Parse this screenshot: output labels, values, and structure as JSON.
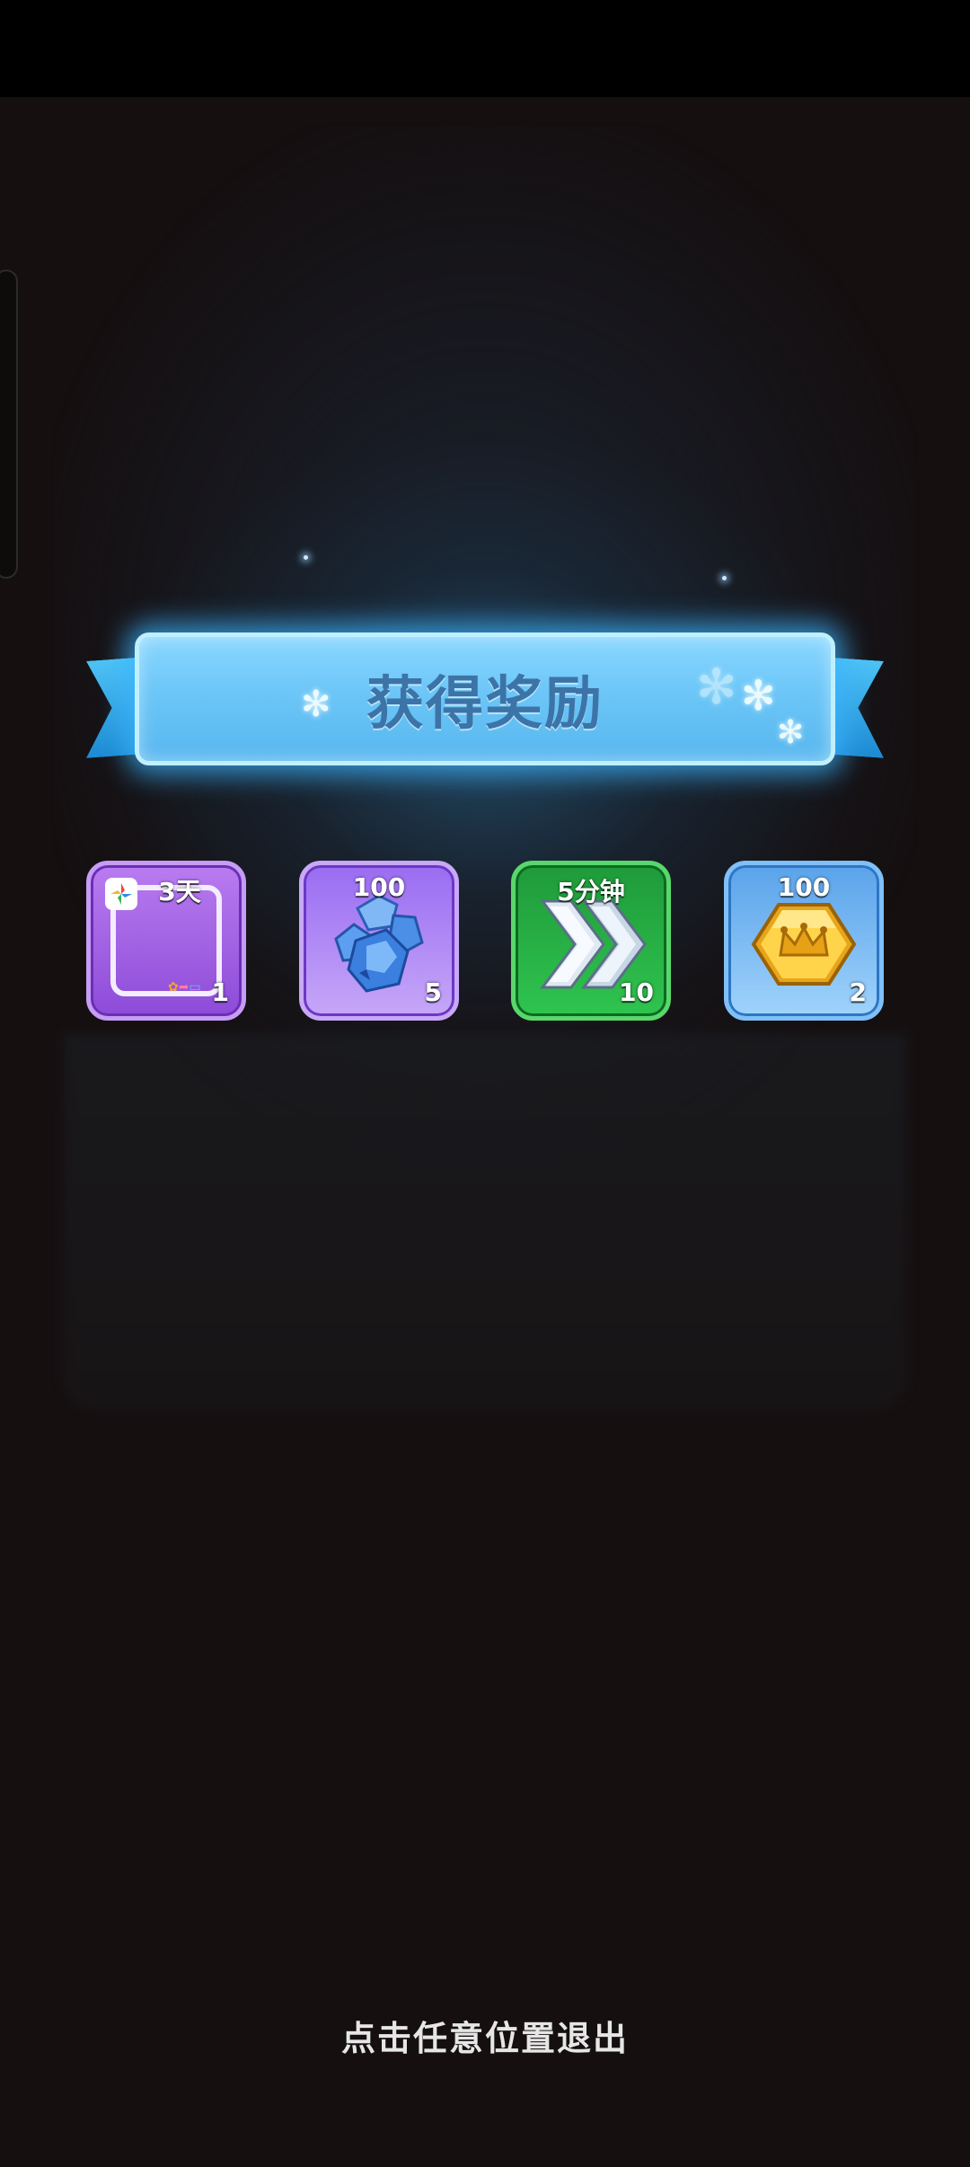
{
  "banner": {
    "title": "获得奖励"
  },
  "rewards": [
    {
      "top_label": "3天",
      "count": "1",
      "icon": "avatar-frame-icon",
      "bg": "#8d4bd8"
    },
    {
      "top_label": "100",
      "count": "5",
      "icon": "blue-gem-pile-icon",
      "bg": "#9a6cf2"
    },
    {
      "top_label": "5分钟",
      "count": "10",
      "icon": "speed-up-arrows-icon",
      "bg": "#2fc44f"
    },
    {
      "top_label": "100",
      "count": "2",
      "icon": "gold-crown-coin-icon",
      "bg": "#5aa3ea"
    }
  ],
  "footer": {
    "exit_hint": "点击任意位置退出"
  },
  "colors": {
    "background": "#150f10",
    "banner_blue": "#6cc6f7",
    "banner_text": "#3c74a8",
    "glow": "#3cb4ff"
  }
}
